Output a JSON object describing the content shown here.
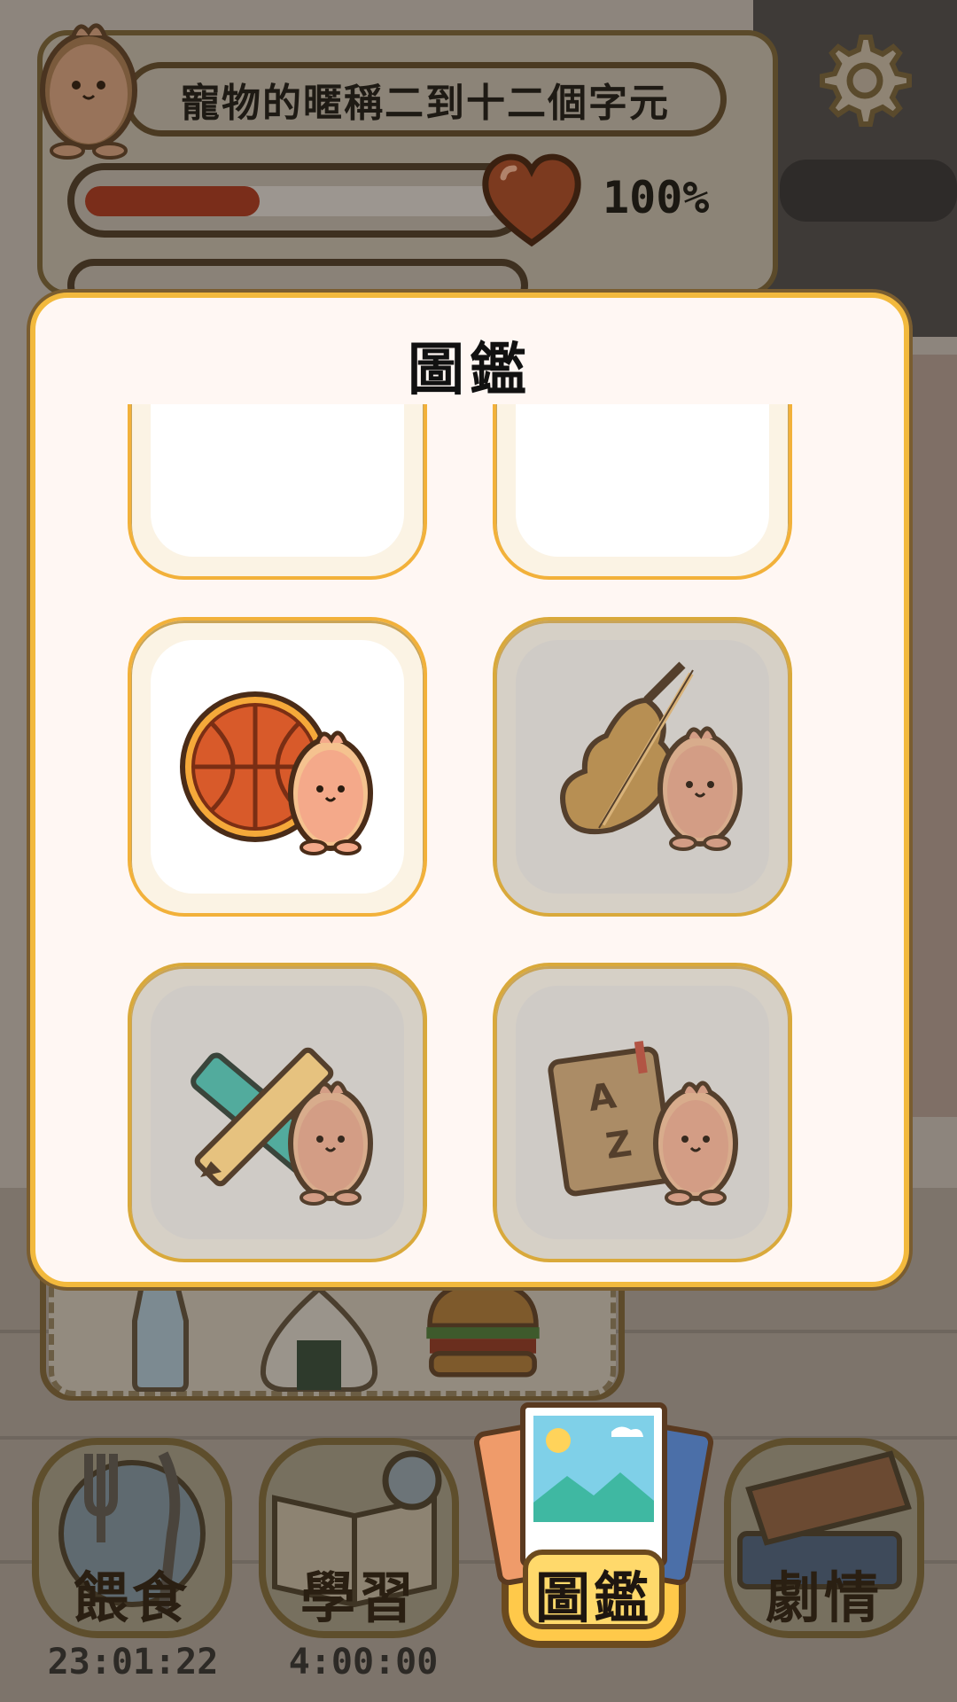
{
  "pet": {
    "name_placeholder": "寵物的暱稱二到十二個字元",
    "health_percent": 100,
    "health_label": "100%",
    "health_fill_fraction": 0.42
  },
  "dialog": {
    "title": "圖鑑",
    "cards": [
      {
        "id": "hidden-1",
        "state": "unlocked",
        "icon": "empty"
      },
      {
        "id": "hidden-2",
        "state": "unlocked",
        "icon": "empty"
      },
      {
        "id": "basketball",
        "state": "unlocked",
        "icon": "basketball-icon"
      },
      {
        "id": "violin",
        "state": "locked",
        "icon": "violin-icon"
      },
      {
        "id": "ruler-pencil",
        "state": "locked",
        "icon": "ruler-pencil-icon"
      },
      {
        "id": "dictionary",
        "state": "locked",
        "icon": "dictionary-icon"
      }
    ]
  },
  "nav": {
    "feed": {
      "label": "餵食",
      "timer": "23:01:22"
    },
    "study": {
      "label": "學習",
      "timer": "4:00:00"
    },
    "gallery": {
      "label": "圖鑑"
    },
    "story": {
      "label": "劇情"
    }
  },
  "colors": {
    "accent": "#f2b93d",
    "dialog_bg": "#fff7f3",
    "card_locked": "#cfcbc6",
    "health_fill": "#7a2d1a"
  }
}
